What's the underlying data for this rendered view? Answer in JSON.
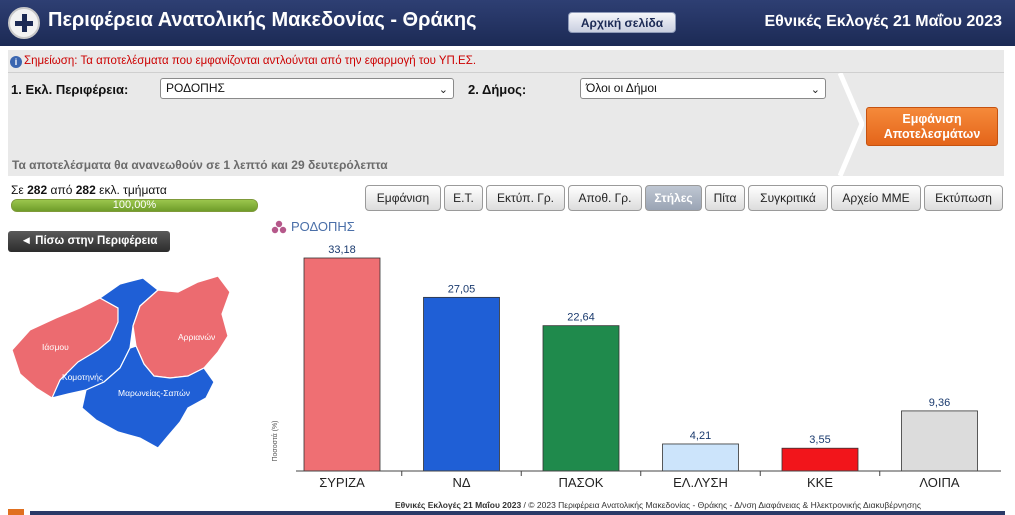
{
  "header": {
    "title": "Περιφέρεια Ανατολικής Μακεδονίας - Θράκης",
    "home_button": "Αρχική σελίδα",
    "election": "Εθνικές Εκλογές 21 Μαΐου 2023"
  },
  "note": "Σημείωση: Τα αποτελέσματα που εμφανίζονται αντλούνται από την εφαρμογή του ΥΠ.ΕΣ.",
  "filters": {
    "region_label": "1. Εκλ. Περιφέρεια:",
    "region_value": "ΡΟΔΟΠΗΣ",
    "municipality_label": "2. Δήμος:",
    "municipality_value": "Όλοι οι Δήμοι",
    "show_button_line1": "Εμφάνιση",
    "show_button_line2": "Αποτελεσμάτων"
  },
  "refresh_text": "Τα αποτελέσματα θα ανανεωθούν σε 1 λεπτό και 29 δευτερόλεπτα",
  "sections": {
    "prefix": "Σε",
    "counted": "282",
    "middle": "από",
    "total": "282",
    "suffix": "εκλ. τμήματα",
    "progress_label": "100,00%",
    "progress_fraction": 1.0
  },
  "view_buttons": [
    {
      "label": "Εμφάνιση",
      "active": false
    },
    {
      "label": "Ε.Τ.",
      "active": false
    },
    {
      "label": "Εκτύπ. Γρ.",
      "active": false
    },
    {
      "label": "Αποθ. Γρ.",
      "active": false
    },
    {
      "label": "Στήλες",
      "active": true
    },
    {
      "label": "Πίτα",
      "active": false
    },
    {
      "label": "Συγκριτικά",
      "active": false
    },
    {
      "label": "Αρχείο ΜΜΕ",
      "active": false
    },
    {
      "label": "Εκτύπωση",
      "active": false
    }
  ],
  "back_button": "◄ Πίσω στην Περιφέρεια",
  "map": {
    "areas": [
      {
        "name": "Ιάσμου",
        "color": "#ec6b70"
      },
      {
        "name": "Αρριανών",
        "color": "#ec6b70"
      },
      {
        "name": "Κομοτηνής",
        "color": "#1f5fd6"
      },
      {
        "name": "Μαρωνείας-Σαπών",
        "color": "#1f5fd6"
      }
    ]
  },
  "region_name": "ΡΟΔΟΠΗΣ",
  "chart_data": {
    "type": "bar",
    "title": "ΡΟΔΟΠΗΣ",
    "ylabel": "Ποσοστά (%)",
    "categories": [
      "ΣΥΡΙΖΑ",
      "ΝΔ",
      "ΠΑΣΟΚ",
      "ΕΛ.ΛΥΣΗ",
      "ΚΚΕ",
      "ΛΟΙΠΑ"
    ],
    "values": [
      33.18,
      27.05,
      22.64,
      4.21,
      3.55,
      9.36
    ],
    "value_labels": [
      "33,18",
      "27,05",
      "22,64",
      "4,21",
      "3,55",
      "9,36"
    ],
    "colors": [
      "#ef6f73",
      "#1f5fd6",
      "#1f8a4c",
      "#cce4fb",
      "#f2151b",
      "#dcdcdc"
    ],
    "ylim": [
      0,
      33.18
    ],
    "grid": false,
    "legend": "none"
  },
  "footer": {
    "bold": "Εθνικές Εκλογές 21 Μαΐου 2023",
    "rest": " / © 2023 Περιφέρεια Ανατολικής Μακεδονίας - Θράκης - Δ/νση Διαφάνειας & Ηλεκτρονικής Διακυβέρνησης"
  }
}
